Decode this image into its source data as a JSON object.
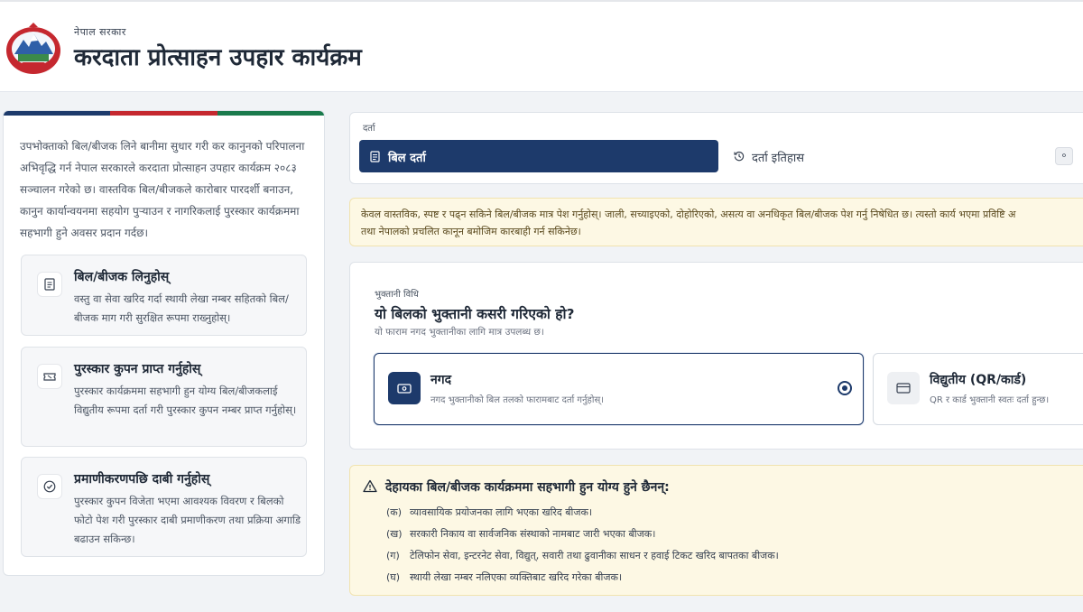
{
  "header": {
    "gov_name": "नेपाल सरकार",
    "program_title": "करदाता प्रोत्साहन उपहार कार्यक्रम"
  },
  "colors": {
    "brand_blue": "#1d3a6b",
    "flag_red": "#c5282f",
    "accent_green": "#1a7a4c",
    "notice_bg": "#fdf8e4"
  },
  "intro": "उपभोक्ताको बिल/बीजक लिने बानीमा सुधार गरी कर कानुनको परिपालना अभिवृद्धि गर्न नेपाल सरकारले करदाता प्रोत्साहन उपहार कार्यक्रम २०८३ सञ्चालन गरेको छ। वास्तविक बिल/बीजकले कारोबार पारदर्शी बनाउन, कानुन कार्यान्वयनमा सहयोग पुऱ्याउन र नागरिकलाई पुरस्कार कार्यक्रममा सहभागी हुने अवसर प्रदान गर्दछ।",
  "steps": [
    {
      "icon": "document-icon",
      "title": "बिल/बीजक लिनुहोस्",
      "text": "वस्तु वा सेवा खरिद गर्दा स्थायी लेखा नम्बर सहितको बिल/बीजक माग गरी सुरक्षित रूपमा राख्नुहोस्।"
    },
    {
      "icon": "ticket-icon",
      "title": "पुरस्कार कुपन प्राप्त गर्नुहोस्",
      "text": "पुरस्कार कार्यक्रममा सहभागी हुन योग्य बिल/बीजकलाई विद्युतीय रूपमा दर्ता गरी पुरस्कार कुपन नम्बर प्राप्त गर्नुहोस्।"
    },
    {
      "icon": "check-circle-icon",
      "title": "प्रमाणीकरणपछि दाबी गर्नुहोस्",
      "text": "पुरस्कार कुपन विजेता भएमा आवश्यक विवरण र बिलको फोटो पेश गरी पुरस्कार दाबी प्रमाणीकरण तथा प्रक्रिया अगाडि बढाउन सकिन्छ।"
    }
  ],
  "tabs": {
    "label": "दर्ता",
    "register": "बिल दर्ता",
    "history": "दर्ता इतिहास",
    "extra": "०"
  },
  "notice": {
    "line1": "केवल वास्तविक, स्पष्ट र पढ्न सकिने बिल/बीजक मात्र पेश गर्नुहोस्। जाली, सच्याइएको, दोहोरिएको, असत्य वा अनधिकृत बिल/बीजक पेश गर्नु निषेधित छ। त्यस्तो कार्य भएमा प्रविष्टि अ",
    "line2": "तथा नेपालको प्रचलित कानून बमोजिम कारबाही गर्न सकिनेछ।"
  },
  "payment": {
    "label": "भुक्तानी विधि",
    "question": "यो बिलको भुक्तानी कसरी गरिएको हो?",
    "subtitle": "यो फाराम नगद भुक्तानीका लागि मात्र उपलब्ध छ।",
    "options": [
      {
        "title": "नगद",
        "desc": "नगद भुक्तानीको बिल तलको फारामबाट दर्ता गर्नुहोस्।",
        "selected": true,
        "icon": "cash-icon"
      },
      {
        "title": "विद्युतीय (QR/कार्ड)",
        "desc": "QR र कार्ड भुक्तानी स्वतः दर्ता हुन्छ।",
        "selected": false,
        "icon": "card-icon"
      }
    ]
  },
  "ineligible": {
    "title": "देहायका बिल/बीजक कार्यक्रममा सहभागी हुन योग्य हुने छैनन्:",
    "items": [
      {
        "mark": "(क)",
        "text": "व्यावसायिक प्रयोजनका लागि भएका खरिद बीजक।"
      },
      {
        "mark": "(ख)",
        "text": "सरकारी निकाय वा सार्वजनिक संस्थाको नामबाट जारी भएका बीजक।"
      },
      {
        "mark": "(ग)",
        "text": "टेलिफोन सेवा, इन्टरनेट सेवा, विद्युत्, सवारी तथा ढुवानीका साधन र हवाई टिकट खरिद बापतका बीजक।"
      },
      {
        "mark": "(घ)",
        "text": "स्थायी लेखा नम्बर नलिएका व्यक्तिबाट खरिद गरेका बीजक।"
      }
    ]
  }
}
